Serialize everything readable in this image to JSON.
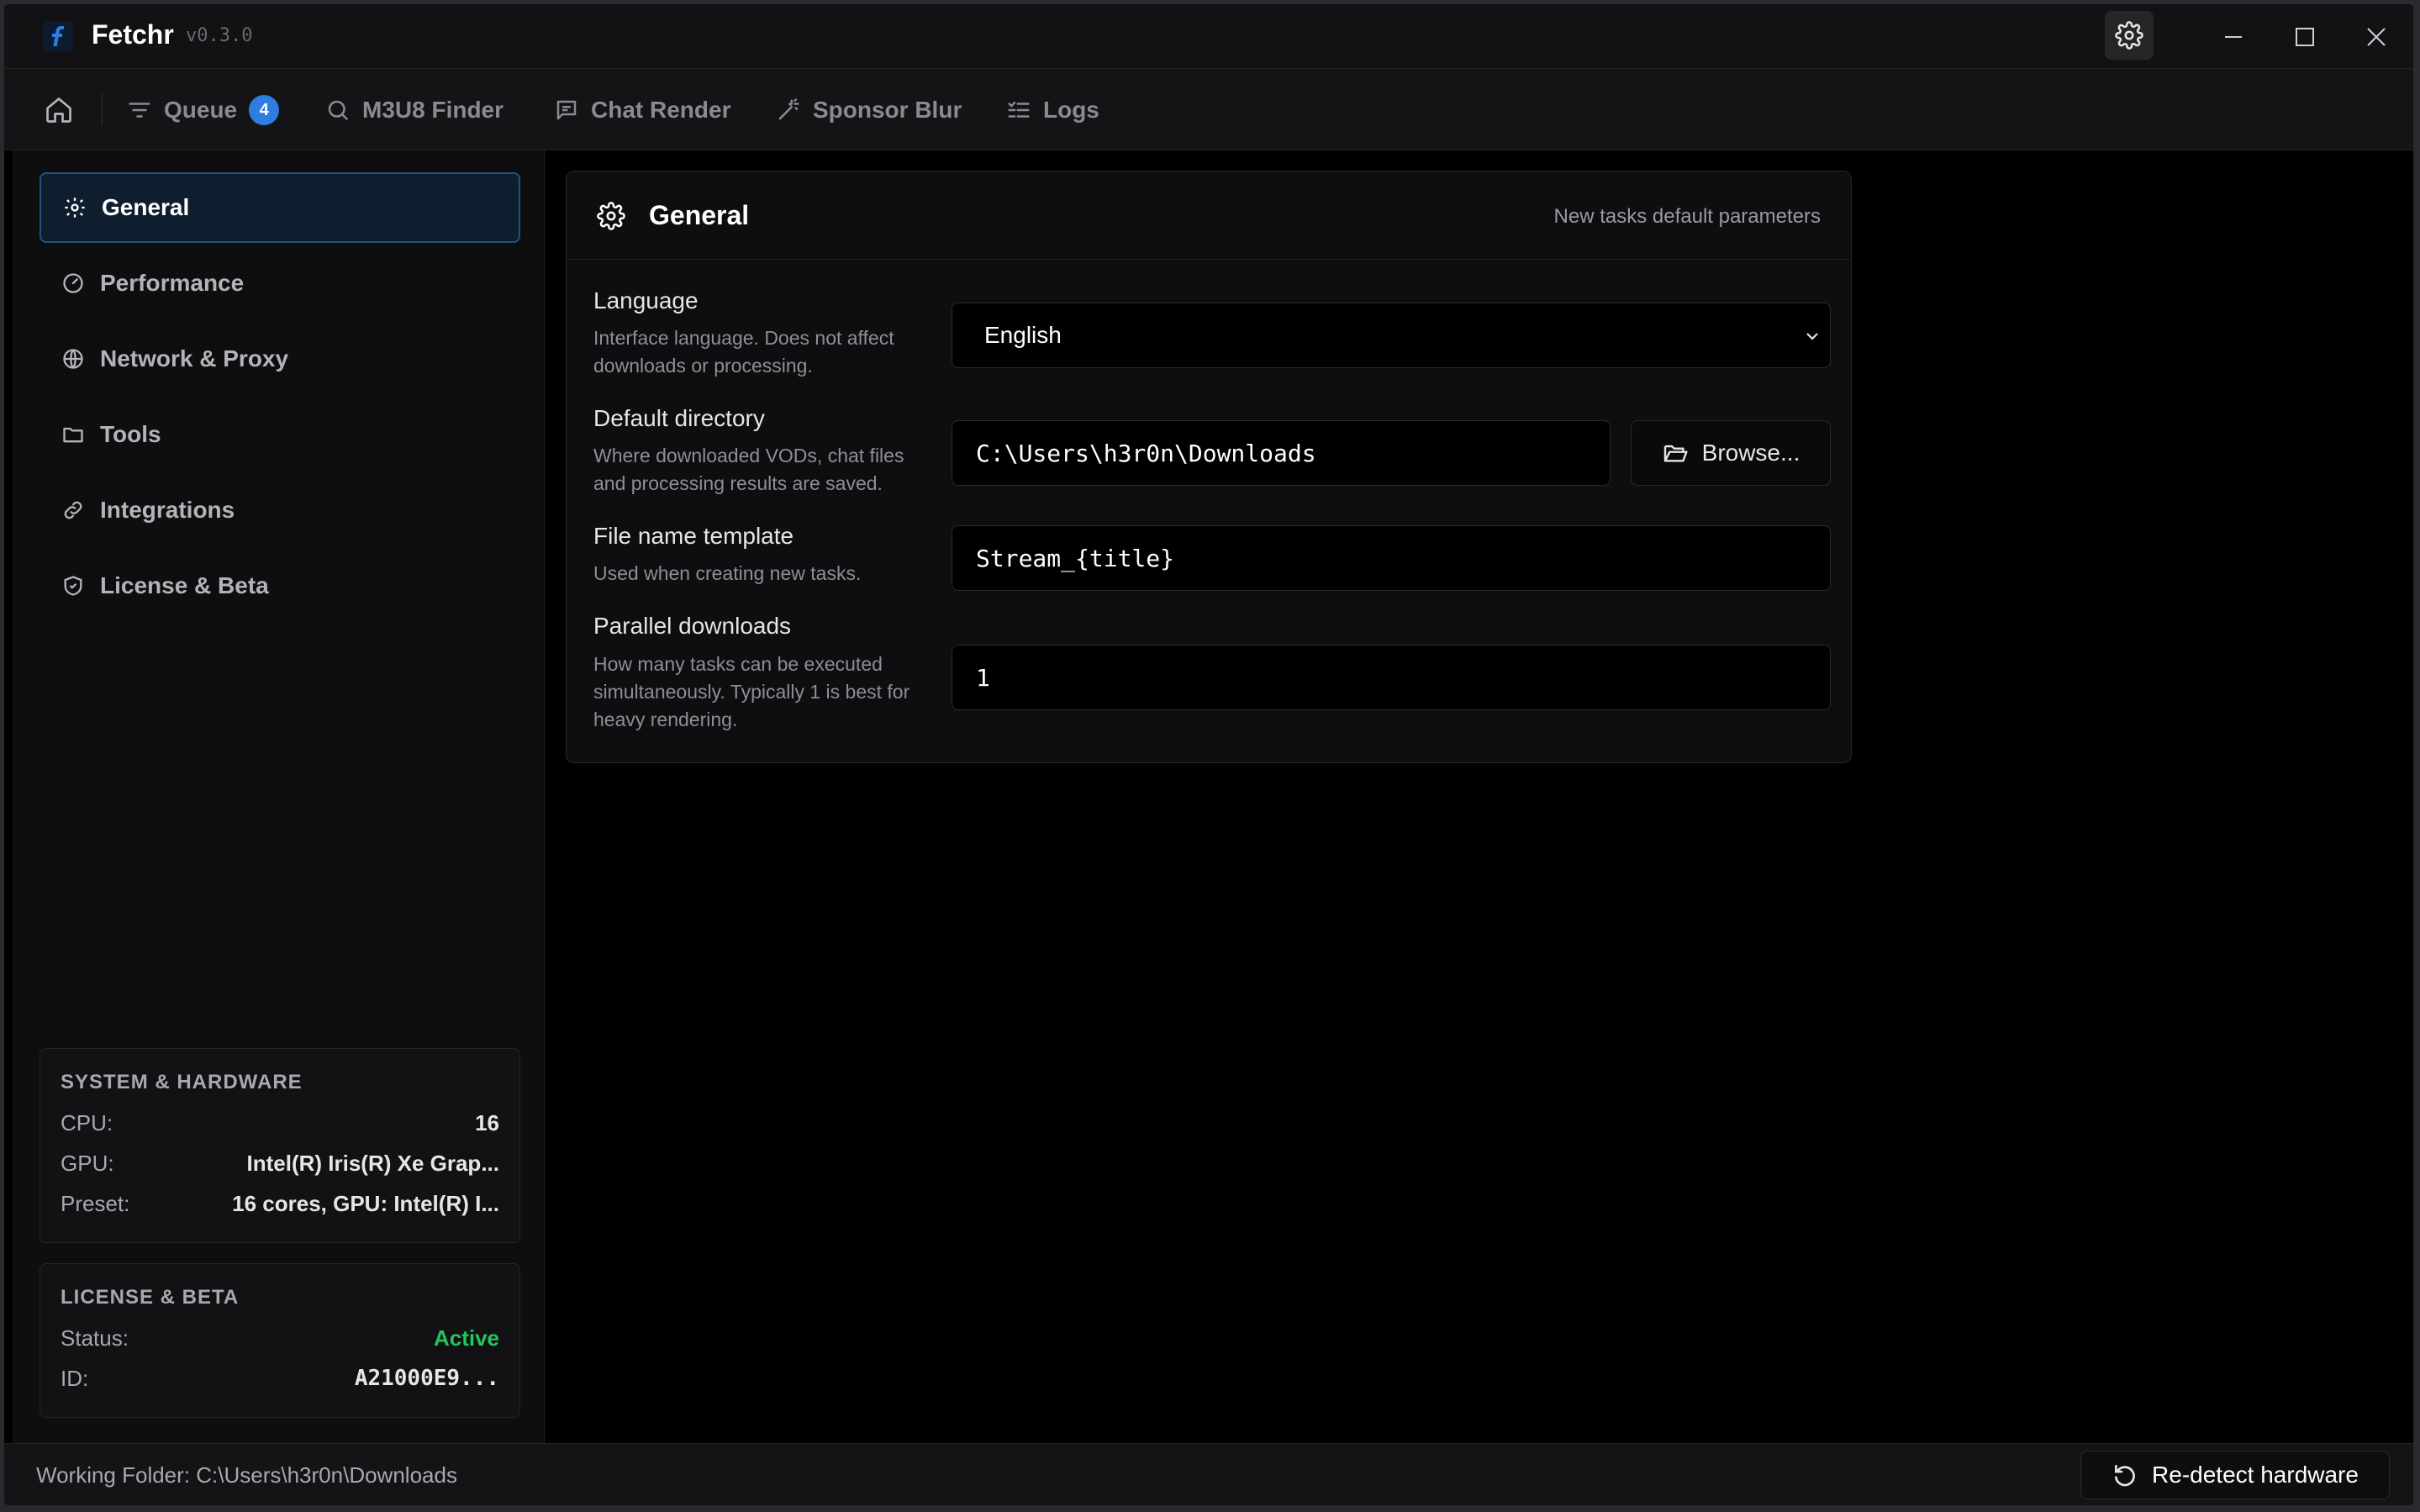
{
  "app": {
    "name": "Fetchr",
    "version": "v0.3.0"
  },
  "nav": {
    "items": [
      {
        "label": "Queue",
        "icon": "filter-icon",
        "badge": "4"
      },
      {
        "label": "M3U8 Finder",
        "icon": "search-icon"
      },
      {
        "label": "Chat Render",
        "icon": "chat-icon"
      },
      {
        "label": "Sponsor Blur",
        "icon": "magic-wand-icon"
      },
      {
        "label": "Logs",
        "icon": "list-check-icon"
      }
    ]
  },
  "sidebar": {
    "items": [
      {
        "label": "General",
        "icon": "gear-icon",
        "active": true
      },
      {
        "label": "Performance",
        "icon": "gauge-icon"
      },
      {
        "label": "Network & Proxy",
        "icon": "globe-icon"
      },
      {
        "label": "Tools",
        "icon": "folder-icon"
      },
      {
        "label": "Integrations",
        "icon": "link-icon"
      },
      {
        "label": "License & Beta",
        "icon": "shield-check-icon"
      }
    ],
    "system": {
      "title": "SYSTEM & HARDWARE",
      "cpu_label": "CPU:",
      "cpu_value": "16",
      "gpu_label": "GPU:",
      "gpu_value": "Intel(R) Iris(R) Xe Grap...",
      "preset_label": "Preset:",
      "preset_value": "16 cores, GPU: Intel(R) I..."
    },
    "license": {
      "title": "LICENSE & BETA",
      "status_label": "Status:",
      "status_value": "Active",
      "status_color": "#22c55e",
      "id_label": "ID:",
      "id_value": "A21000E9..."
    }
  },
  "card": {
    "title": "General",
    "subtitle": "New tasks default parameters",
    "language": {
      "label": "Language",
      "desc": "Interface language. Does not affect downloads or processing.",
      "value": "English"
    },
    "directory": {
      "label": "Default directory",
      "desc": "Where downloaded VODs, chat files and processing results are saved.",
      "value": "C:\\Users\\h3r0n\\Downloads",
      "browse_label": "Browse..."
    },
    "template": {
      "label": "File name template",
      "desc": "Used when creating new tasks.",
      "value": "Stream_{title}"
    },
    "parallel": {
      "label": "Parallel downloads",
      "desc": "How many tasks can be executed simultaneously. Typically 1 is best for heavy rendering.",
      "value": "1"
    }
  },
  "status": {
    "working_folder": "Working Folder: C:\\Users\\h3r0n\\Downloads",
    "redetect_label": "Re-detect hardware"
  },
  "colors": {
    "accent": "#2f7de1",
    "active_bg": "#0f1e2e",
    "active_border": "#27507c"
  }
}
